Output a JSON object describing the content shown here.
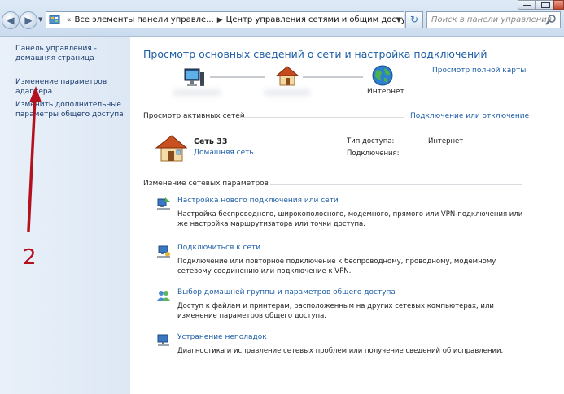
{
  "window": {
    "address_crumbs": [
      "Все элементы панели управле...",
      "Центр управления сетями и общим доступом"
    ],
    "search_placeholder": "Поиск в панели управления"
  },
  "sidebar": {
    "items": [
      {
        "label": "Панель управления -\nдомашняя страница"
      },
      {
        "label": "Изменение параметров\nадаптера"
      },
      {
        "label": "Изменить дополнительные\nпараметры общего доступа"
      }
    ],
    "annotation": "2"
  },
  "main": {
    "title": "Просмотр основных сведений о сети и настройка подключений",
    "full_map_link": "Просмотр полной карты",
    "map_internet_label": "Интернет",
    "active_networks_heading": "Просмотр активных сетей",
    "connect_disconnect_link": "Подключение или отключение",
    "network": {
      "name": "Сеть  33",
      "type": "Домашняя сеть",
      "access_type_label": "Тип доступа:",
      "access_type_value": "Интернет",
      "connections_label": "Подключения:"
    },
    "change_settings_heading": "Изменение сетевых параметров",
    "tasks": [
      {
        "title": "Настройка нового подключения или сети",
        "desc": "Настройка беспроводного, широкополосного, модемного, прямого или VPN-подключения или же настройка маршрутизатора или точки доступа."
      },
      {
        "title": "Подключиться к сети",
        "desc": "Подключение или повторное подключение к беспроводному, проводному, модемному сетевому соединению или подключение к VPN."
      },
      {
        "title": "Выбор домашней группы и параметров общего доступа",
        "desc": "Доступ к файлам и принтерам, расположенным на других сетевых компьютерах, или изменение параметров общего доступа."
      },
      {
        "title": "Устранение неполадок",
        "desc": "Диагностика и исправление сетевых проблем или получение сведений об исправлении."
      }
    ]
  },
  "colors": {
    "link": "#1e5ea6",
    "annotation": "#b4111f",
    "sidebar_bg": "#e3ecf7"
  }
}
